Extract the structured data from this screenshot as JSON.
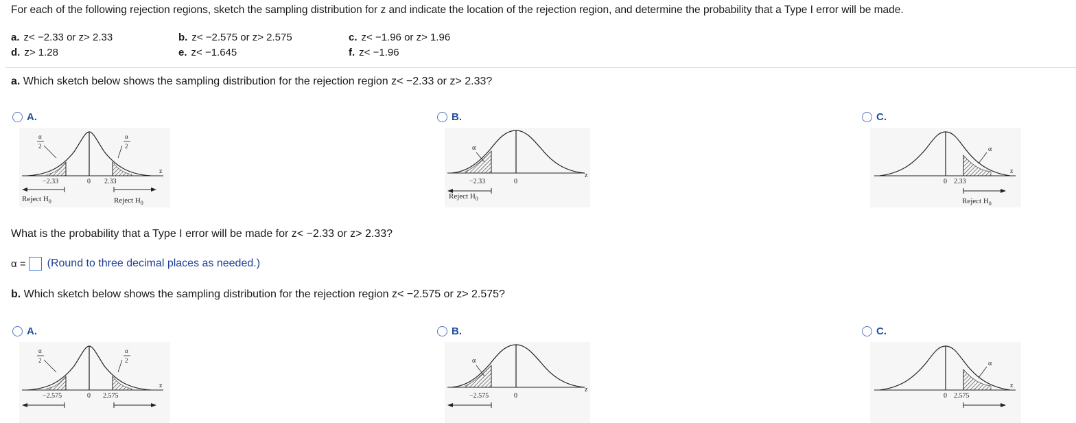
{
  "intro": "For each of the following rejection regions, sketch the sampling distribution for z and indicate the location of the rejection region, and determine the probability that a Type I error will be made.",
  "parts": [
    {
      "letter": "a.",
      "text": "z< −2.33 or z> 2.33"
    },
    {
      "letter": "b.",
      "text": "z< −2.575 or z> 2.575"
    },
    {
      "letter": "c.",
      "text": "z< −1.96 or z> 1.96"
    },
    {
      "letter": "d.",
      "text": "z> 1.28"
    },
    {
      "letter": "e.",
      "text": "z< −1.645"
    },
    {
      "letter": "f.",
      "text": "z< −1.96"
    }
  ],
  "question_a": {
    "letter": "a.",
    "text": "Which sketch below shows the sampling distribution for the rejection region z< −2.33 or z> 2.33?"
  },
  "question_b": {
    "letter": "b.",
    "text": "Which sketch below shows the sampling distribution for the rejection region z< −2.575 or z> 2.575?"
  },
  "options": {
    "A": "A.",
    "B": "B.",
    "C": "C."
  },
  "sketch_text": {
    "alpha": "α",
    "alpha_half_num": "α",
    "alpha_half_den": "2",
    "z": "z",
    "zero": "0",
    "reject": "Reject H",
    "reject_sub": "0"
  },
  "sketches_a": {
    "neg": "−2.33",
    "pos": "2.33"
  },
  "sketches_b": {
    "neg": "−2.575",
    "pos": "2.575"
  },
  "prob_question": "What is the probability that a Type I error will be made for z< −2.33 or z> 2.33?",
  "alpha_label": "α =",
  "answer_value": "",
  "round_hint": "(Round to three decimal places as needed.)",
  "colors": {
    "accent": "#1f4e9c",
    "hint": "#1f3f95",
    "radio": "#5a78b8",
    "input_border": "#3a7bd5"
  }
}
